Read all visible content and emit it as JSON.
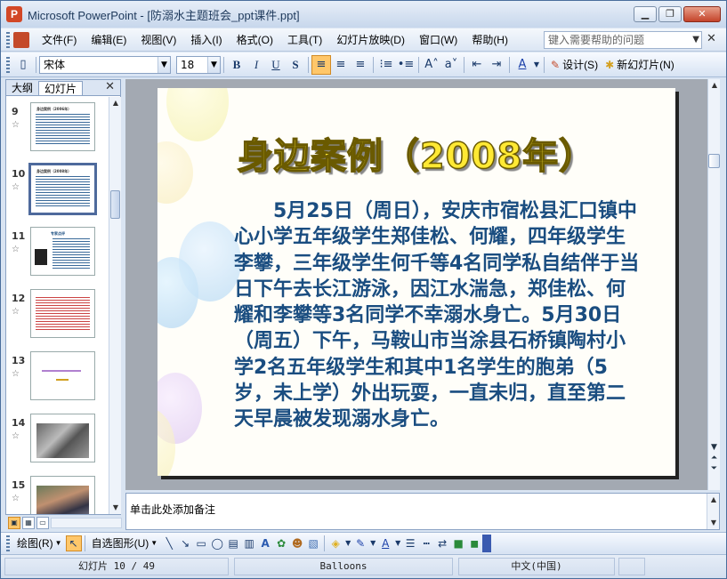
{
  "window": {
    "title": "Microsoft PowerPoint - [防溺水主题班会_ppt课件.ppt]",
    "app_icon_letter": "P",
    "minimize_icon": "minimize-icon",
    "restore_icon": "restore-icon",
    "close_icon": "close-icon"
  },
  "menu": {
    "items": [
      "文件(F)",
      "编辑(E)",
      "视图(V)",
      "插入(I)",
      "格式(O)",
      "工具(T)",
      "幻灯片放映(D)",
      "窗口(W)",
      "帮助(H)"
    ],
    "help_placeholder": "键入需要帮助的问题"
  },
  "toolbar": {
    "font_name": "宋体",
    "font_size": "18",
    "bold": "B",
    "italic": "I",
    "underline": "U",
    "shadow": "S",
    "design_label": "设计(S)",
    "new_slide_label": "新幻灯片(N)"
  },
  "left_pane": {
    "tab_outline": "大纲",
    "tab_slides": "幻灯片",
    "selected_slide": 10,
    "thumbnails": [
      {
        "number": "9",
        "title": "身边案例（2006年）",
        "kind": "text"
      },
      {
        "number": "10",
        "title": "身边案例（2008年）",
        "kind": "text"
      },
      {
        "number": "11",
        "title": "专家点评",
        "kind": "mixed"
      },
      {
        "number": "12",
        "title": "",
        "kind": "red-text"
      },
      {
        "number": "13",
        "title": "",
        "kind": "sparse"
      },
      {
        "number": "14",
        "title": "",
        "kind": "photo"
      },
      {
        "number": "15",
        "title": "",
        "kind": "photo"
      }
    ]
  },
  "slide": {
    "title": "身边案例（2008年）",
    "body": "5月25日（周日），安庆市宿松县汇口镇中心小学五年级学生郑佳松、何耀，四年级学生李攀，三年级学生何千等4名同学私自结伴于当日下午去长江游泳，因江水湍急，郑佳松、何耀和李攀等3名同学不幸溺水身亡。5月30日（周五）下午，马鞍山市当涂县石桥镇陶村小学2名五年级学生和其中1名学生的胞弟（5岁，未上学）外出玩耍，一直未归，直至第二天早晨被发现溺水身亡。",
    "title_color": "#ffe934",
    "body_color": "#1a4d80"
  },
  "notes": {
    "placeholder": "单击此处添加备注"
  },
  "drawbar": {
    "draw_label": "绘图(R)",
    "autoshape_label": "自选图形(U)"
  },
  "status": {
    "slide_info": "幻灯片 10 / 49",
    "design": "Balloons",
    "language": "中文(中国)"
  }
}
